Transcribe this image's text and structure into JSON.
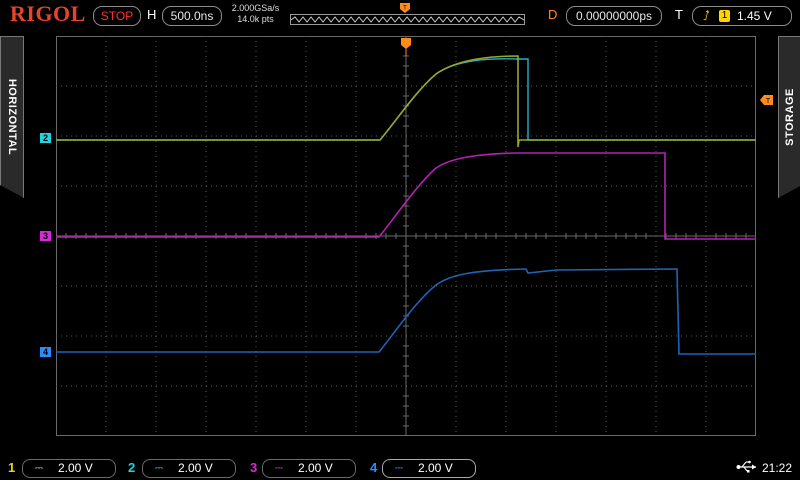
{
  "brand": "RIGOL",
  "status": "STOP",
  "horizontal": {
    "label": "H",
    "timebase": "500.0ns"
  },
  "acquisition": {
    "sample_rate": "2.000GSa/s",
    "memory_depth": "14.0k pts"
  },
  "delay": {
    "label": "D",
    "value": "0.00000000ps"
  },
  "trigger": {
    "label": "T",
    "edge_icon": "rising-edge-icon",
    "source": "1",
    "level": "1.45 V"
  },
  "side_tabs": {
    "left": "HORIZONTAL",
    "right": "STORAGE"
  },
  "channels": [
    {
      "number": "1",
      "scale": "2.00 V",
      "color": "#e6d21a",
      "coupling": "DC"
    },
    {
      "number": "2",
      "scale": "2.00 V",
      "color": "#1fd3e0",
      "coupling": "DC"
    },
    {
      "number": "3",
      "scale": "2.00 V",
      "color": "#d62ad6",
      "coupling": "DC"
    },
    {
      "number": "4",
      "scale": "2.00 V",
      "color": "#2a8cff",
      "coupling": "DC"
    }
  ],
  "trace_markers": {
    "ch2": "2",
    "ch3": "3",
    "ch4": "4"
  },
  "clock": "21:22",
  "colors": {
    "brand": "#e8442a",
    "stop": "#ff3030",
    "trigger_marker": "#ff8c1a",
    "grid": "#5a5a5a"
  }
}
